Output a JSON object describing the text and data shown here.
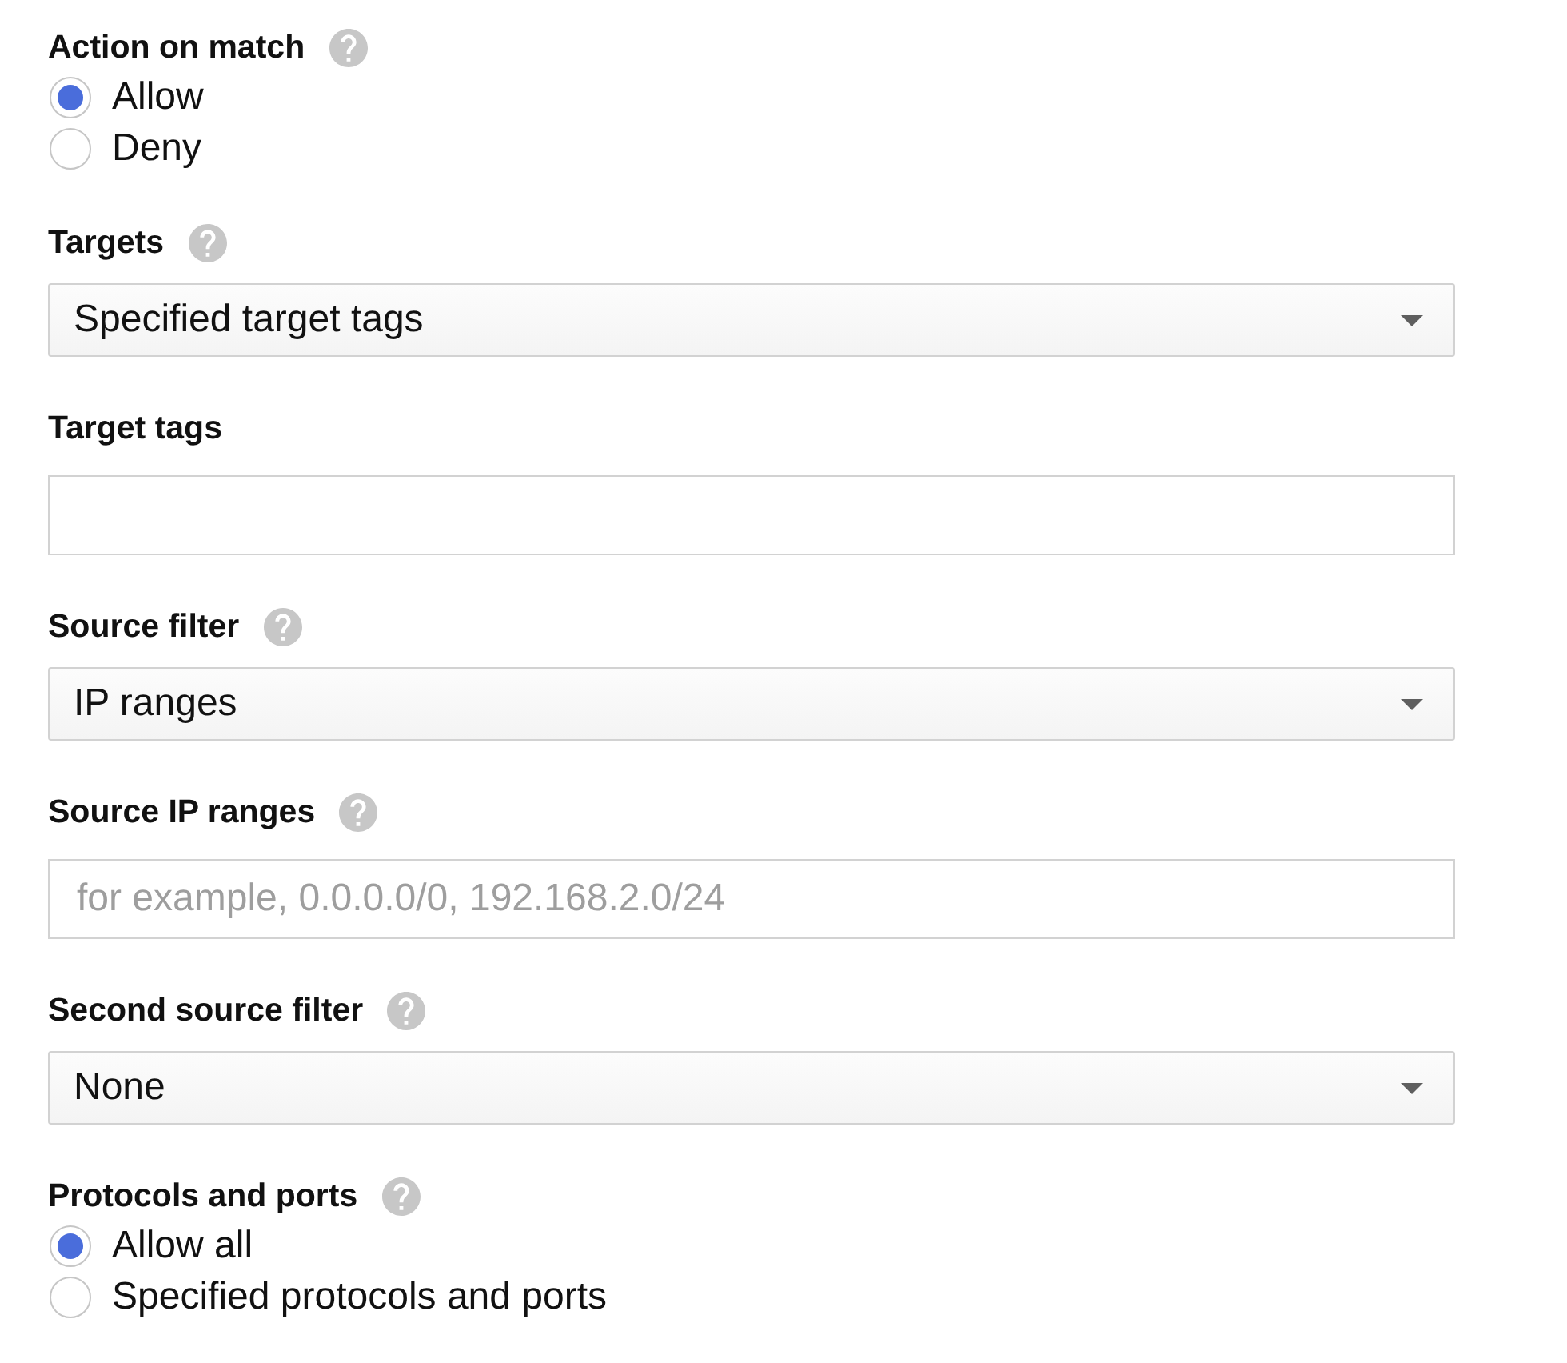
{
  "fields": [
    {
      "kind": "radio_group",
      "label": "Action on match",
      "help": true,
      "options": [
        {
          "label": "Allow",
          "selected": true
        },
        {
          "label": "Deny",
          "selected": false
        }
      ]
    },
    {
      "kind": "select",
      "label": "Targets",
      "help": true,
      "value": "Specified target tags"
    },
    {
      "kind": "text_input",
      "label": "Target tags",
      "help": false
    },
    {
      "kind": "select",
      "label": "Source filter",
      "help": true,
      "value": "IP ranges"
    },
    {
      "kind": "text_input",
      "label": "Source IP ranges",
      "help": true,
      "placeholder": "for example, 0.0.0.0/0, 192.168.2.0/24"
    },
    {
      "kind": "select",
      "label": "Second source filter",
      "help": true,
      "value": "None"
    },
    {
      "kind": "radio_group",
      "label": "Protocols and ports",
      "help": true,
      "options": [
        {
          "label": "Allow all",
          "selected": true
        },
        {
          "label": "Specified protocols and ports",
          "selected": false
        }
      ]
    }
  ]
}
